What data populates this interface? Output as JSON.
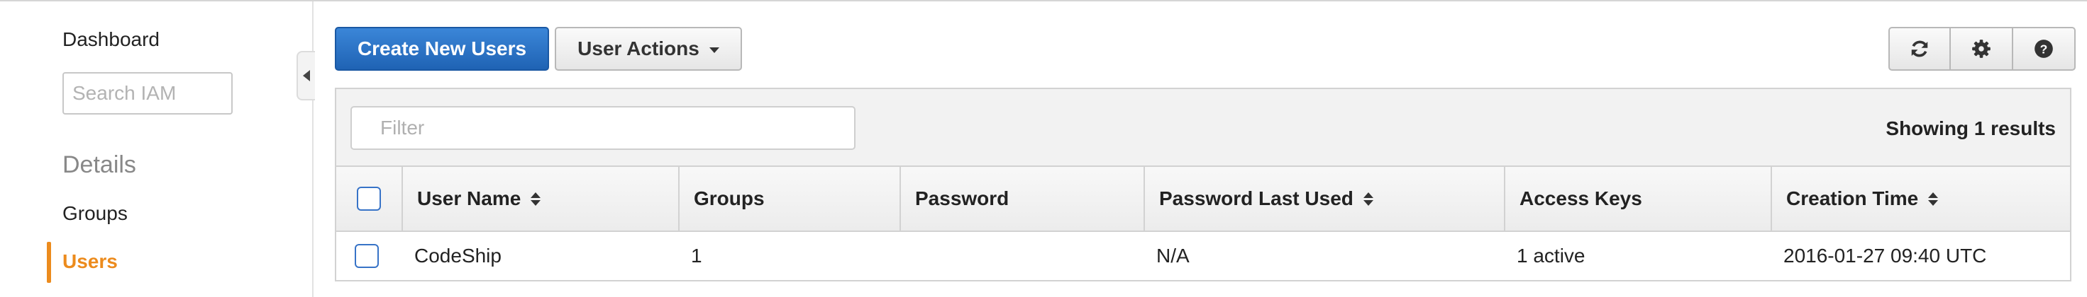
{
  "sidebar": {
    "dashboard": "Dashboard",
    "search_placeholder": "Search IAM",
    "section_title": "Details",
    "groups": "Groups",
    "users": "Users"
  },
  "toolbar": {
    "create_label": "Create New Users",
    "actions_label": "User Actions",
    "icons": [
      "refresh-icon",
      "gear-icon",
      "help-icon"
    ]
  },
  "table": {
    "filter_placeholder": "Filter",
    "showing": "Showing 1 results",
    "columns": [
      "User Name",
      "Groups",
      "Password",
      "Password Last Used",
      "Access Keys",
      "Creation Time"
    ],
    "rows": [
      {
        "user_name": "CodeShip",
        "groups": "1",
        "password": "",
        "password_last_used": "N/A",
        "access_keys": "1 active",
        "creation_time": "2016-01-27 09:40 UTC"
      }
    ]
  },
  "colors": {
    "accent": "#ec8b1d",
    "primary": "#1f63b4",
    "checkbox": "#3773c7"
  }
}
